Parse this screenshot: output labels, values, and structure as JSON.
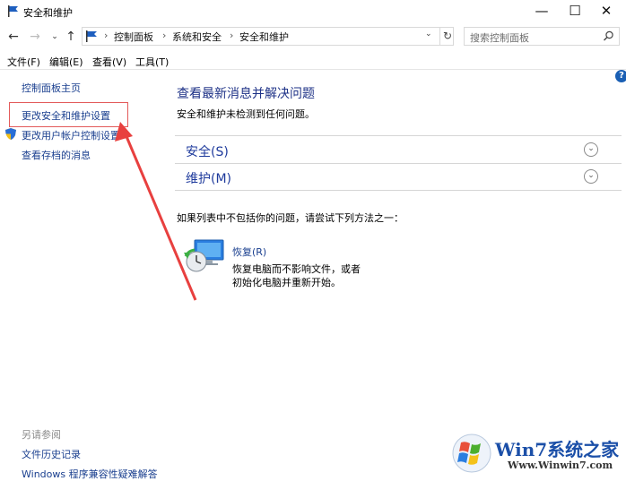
{
  "window": {
    "title": "安全和维护"
  },
  "nav": {
    "breadcrumbs": [
      "控制面板",
      "系统和安全",
      "安全和维护"
    ],
    "search_placeholder": "搜索控制面板"
  },
  "menu": [
    "文件(F)",
    "编辑(E)",
    "查看(V)",
    "工具(T)"
  ],
  "sidebar": {
    "items": [
      "控制面板主页",
      "更改安全和维护设置",
      "更改用户帐户控制设置",
      "查看存档的消息"
    ],
    "see_also_label": "另请参阅",
    "see_also": [
      "文件历史记录",
      "Windows 程序兼容性疑难解答"
    ]
  },
  "main": {
    "title": "查看最新消息并解决问题",
    "status": "安全和维护未检测到任何问题。",
    "sections": [
      "安全(S)",
      "维护(M)"
    ],
    "hint": "如果列表中不包括你的问题，请尝试下列方法之一：",
    "recovery": {
      "link": "恢复(R)",
      "desc_line1": "恢复电脑而不影响文件，或者",
      "desc_line2": "初始化电脑并重新开始。"
    }
  },
  "watermark": {
    "text": "Win7系统之家",
    "url": "Www.Winwin7.com"
  },
  "colors": {
    "link": "#1a3f8f",
    "heading": "#1e3287",
    "highlight": "#e35a5a"
  },
  "icons": [
    "flag-icon",
    "back-icon",
    "forward-icon",
    "up-icon",
    "refresh-icon",
    "search-icon",
    "shield-icon",
    "help-icon",
    "recovery-icon"
  ]
}
